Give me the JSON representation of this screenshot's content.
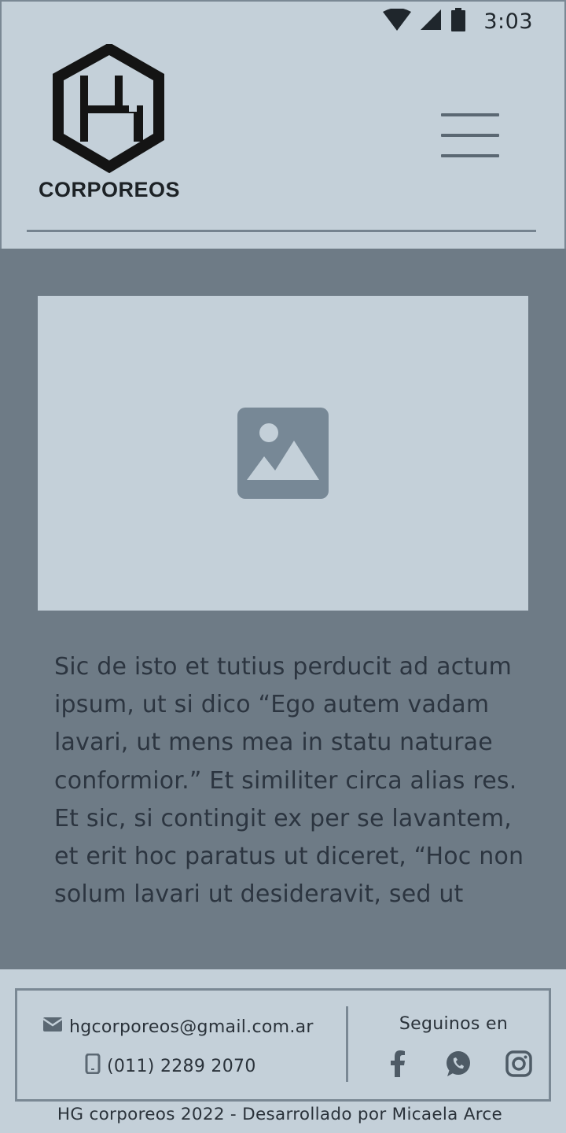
{
  "status_bar": {
    "time": "3:03",
    "icons": [
      "wifi-icon",
      "signal-icon",
      "battery-icon"
    ]
  },
  "header": {
    "logo_text": "CORPOREOS",
    "menu_icon": "hamburger-menu-icon"
  },
  "main": {
    "image_icon": "image-placeholder-icon",
    "paragraph": "Sic de isto et tutius perducit ad actum ipsum, ut si dico “Ego autem vadam lavari, ut mens mea in statu naturae conformior.” Et similiter circa alias res. Et sic, si contingit ex per se lavantem, et erit hoc paratus ut diceret, “Hoc non solum lavari ut desideravit, sed ut"
  },
  "footer": {
    "email": "hgcorporeos@gmail.com.ar",
    "phone": "(011) 2289 2070",
    "social_title": "Seguinos en",
    "social_icons": [
      "facebook-icon",
      "whatsapp-icon",
      "instagram-icon"
    ],
    "copyright": "HG corporeos 2022 - Desarrollado por Micaela Arce"
  },
  "colors": {
    "background": "#c4d0d9",
    "main_background": "#6e7b86",
    "border": "#7a8894",
    "text": "#2a323a"
  }
}
